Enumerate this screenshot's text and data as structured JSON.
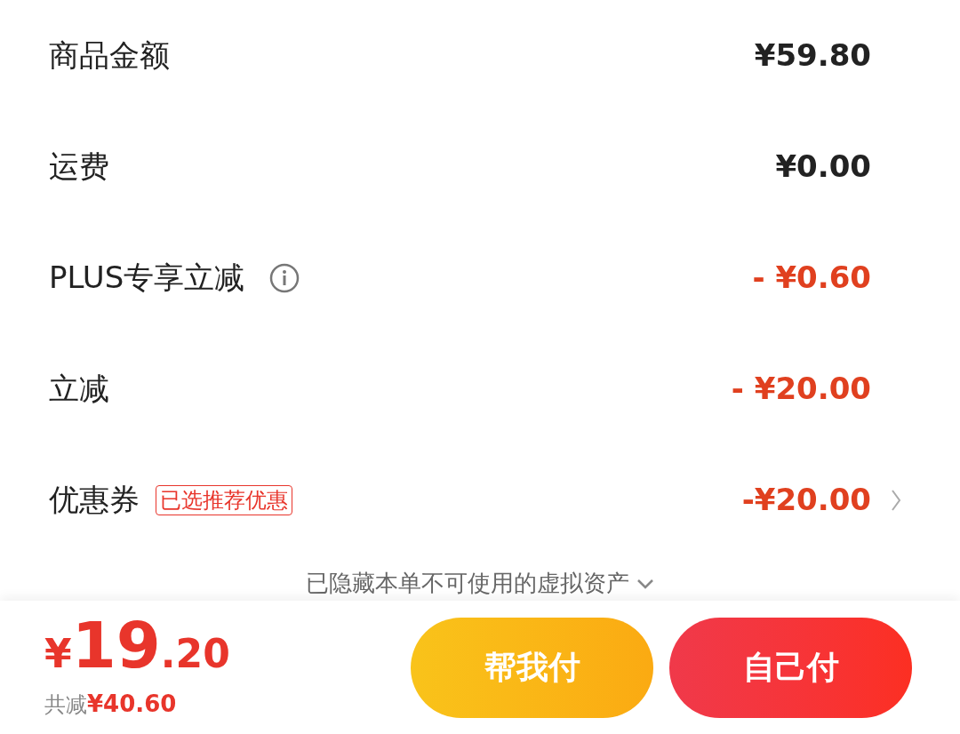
{
  "rows": [
    {
      "label": "商品金额",
      "amount": "¥59.80",
      "kind": "charge"
    },
    {
      "label": "运费",
      "amount": "¥0.00",
      "kind": "charge"
    },
    {
      "label": "PLUS专享立减",
      "amount": "- ¥0.60",
      "kind": "discount",
      "info": true
    },
    {
      "label": "立减",
      "amount": "- ¥20.00",
      "kind": "discount"
    },
    {
      "label": "优惠券",
      "badge": "已选推荐优惠",
      "amount": "-¥20.00",
      "kind": "discount",
      "chevron": true
    }
  ],
  "hidden_note": "已隐藏本单不可使用的虚拟资产",
  "footer": {
    "currency": "¥",
    "integer": "19",
    "decimal": ".20",
    "saved_label": "共减",
    "saved_amount": "¥40.60"
  },
  "buttons": [
    {
      "label": "帮我付",
      "kind": "friend"
    },
    {
      "label": "自己付",
      "kind": "self"
    }
  ]
}
